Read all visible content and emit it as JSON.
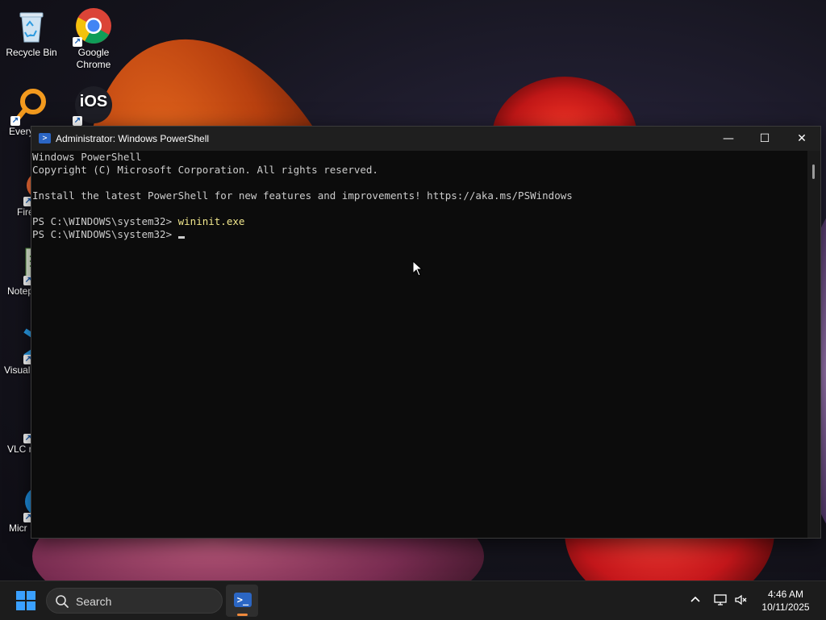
{
  "desktop": {
    "icons": [
      {
        "label": "Recycle Bin"
      },
      {
        "label": "Google Chrome"
      },
      {
        "label": "Every",
        "badge": "iOS"
      },
      {
        "label": "iOS"
      },
      {
        "label": "Fire"
      },
      {
        "label": "Notep"
      },
      {
        "label": "Visual Co"
      },
      {
        "label": "VLC m pla"
      },
      {
        "label": "Micr Edge"
      }
    ]
  },
  "window": {
    "title": "Administrator: Windows PowerShell",
    "minimize_glyph": "—",
    "maximize_glyph": "☐",
    "close_glyph": "✕",
    "console": {
      "lines": [
        "Windows PowerShell",
        "Copyright (C) Microsoft Corporation. All rights reserved.",
        "",
        "Install the latest PowerShell for new features and improvements! https://aka.ms/PSWindows",
        ""
      ],
      "prompt1": "PS C:\\WINDOWS\\system32> ",
      "command1": "wininit.exe",
      "prompt2": "PS C:\\WINDOWS\\system32> "
    }
  },
  "taskbar": {
    "search_label": "Search",
    "clock_time": "4:46 AM",
    "clock_date": "10/11/2025",
    "colors": {
      "accent": "#f08a3c",
      "powershell": "#2b66c4",
      "windows_blue": "#3aa0ff"
    }
  }
}
